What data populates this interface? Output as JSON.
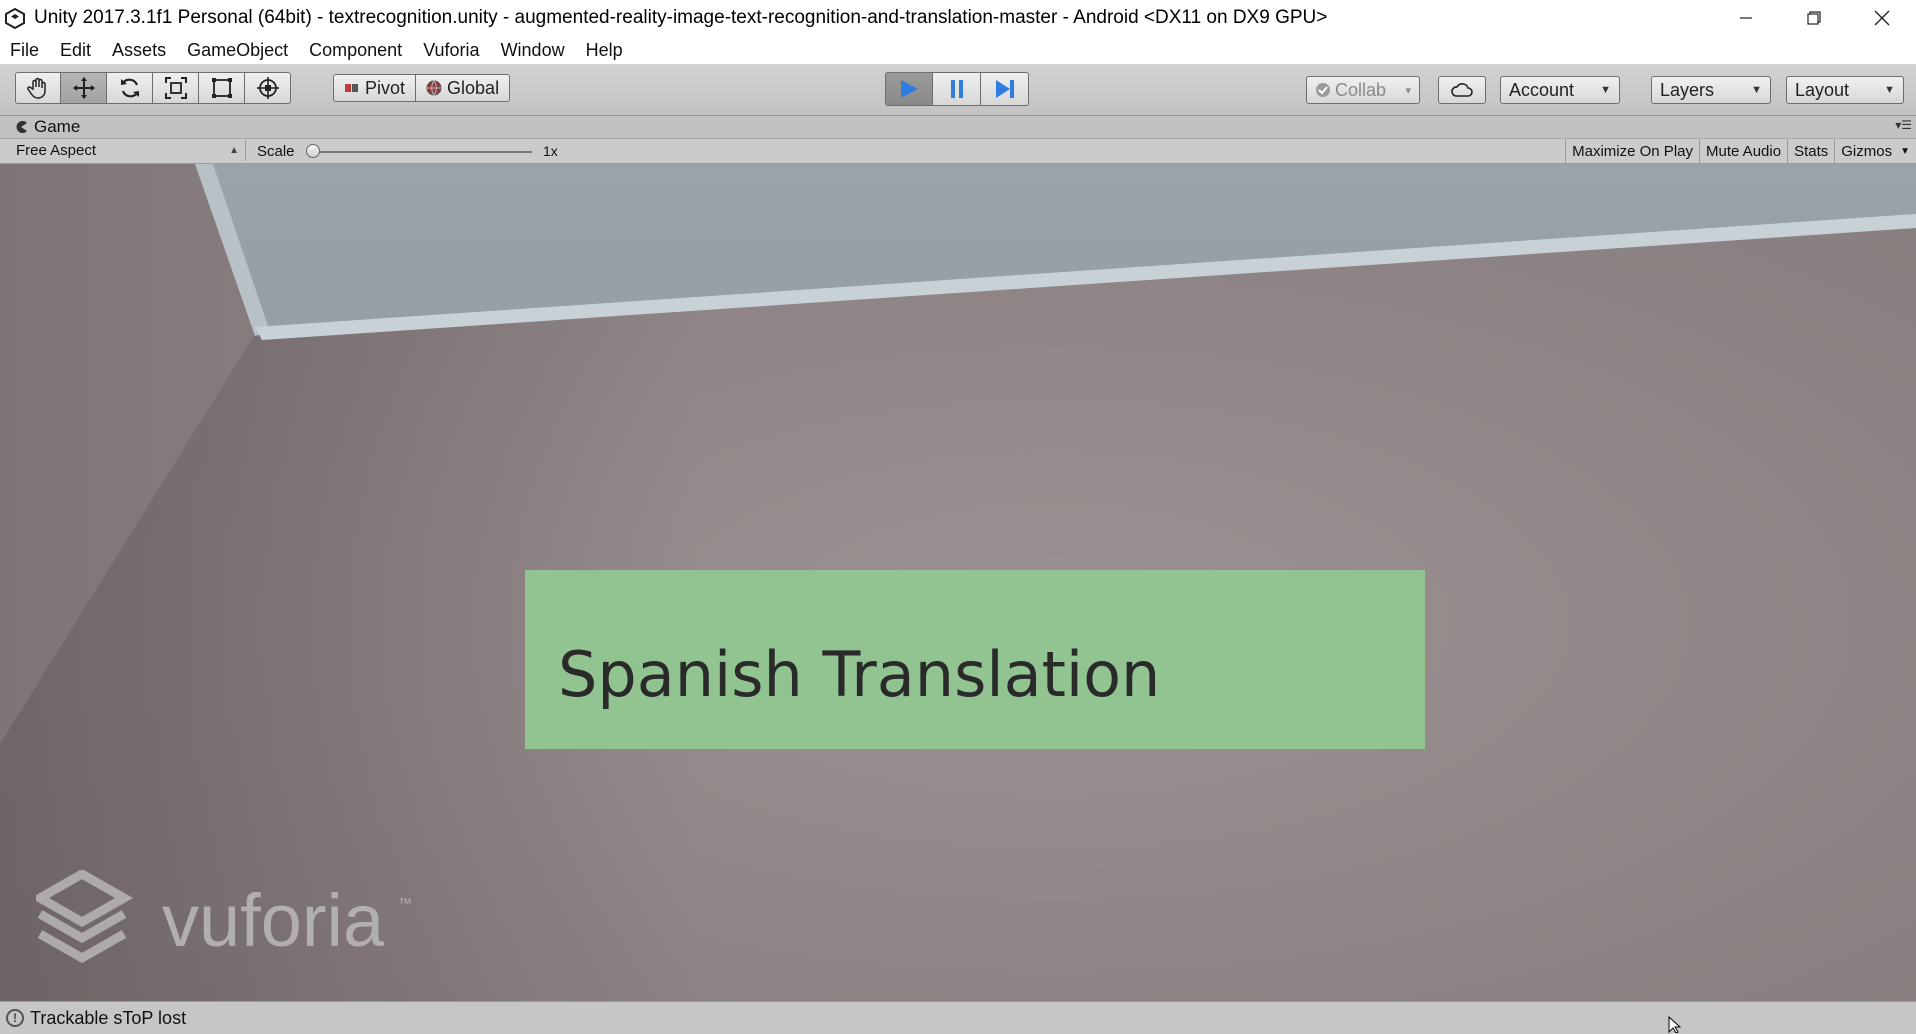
{
  "window": {
    "title": "Unity 2017.3.1f1 Personal (64bit) - textrecognition.unity - augmented-reality-image-text-recognition-and-translation-master - Android <DX11 on DX9 GPU>"
  },
  "menu": {
    "items": [
      "File",
      "Edit",
      "Assets",
      "GameObject",
      "Component",
      "Vuforia",
      "Window",
      "Help"
    ]
  },
  "toolbar": {
    "transform_tools": [
      "hand-icon",
      "move-icon",
      "rotate-icon",
      "scale-icon",
      "rect-icon",
      "transform-icon"
    ],
    "active_tool": "move-icon",
    "pivot_label": "Pivot",
    "global_label": "Global",
    "play_state": "playing",
    "collab_label": "Collab",
    "account_label": "Account",
    "layers_label": "Layers",
    "layout_label": "Layout",
    "accent_color": "#2f7de0"
  },
  "game_panel": {
    "tab_label": "Game",
    "aspect_label": "Free Aspect",
    "scale_label": "Scale",
    "scale_value": "1x",
    "buttons": [
      "Maximize On Play",
      "Mute Audio",
      "Stats",
      "Gizmos"
    ]
  },
  "game_view": {
    "translation_text": "Spanish Translation",
    "panel_color": "#92c492",
    "watermark": "vuforia"
  },
  "status": {
    "message": "Trackable sToP lost"
  }
}
